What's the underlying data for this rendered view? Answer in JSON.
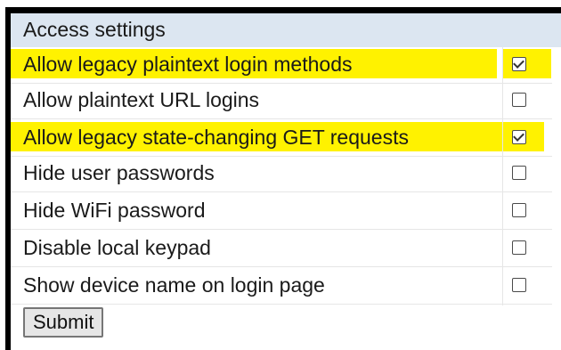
{
  "panel": {
    "title": "Access settings"
  },
  "settings": [
    {
      "label": "Allow legacy plaintext login methods",
      "checked": true,
      "highlighted": true
    },
    {
      "label": "Allow plaintext URL logins",
      "checked": false,
      "highlighted": false
    },
    {
      "label": "Allow legacy state-changing GET requests",
      "checked": true,
      "highlighted": true
    },
    {
      "label": "Hide user passwords",
      "checked": false,
      "highlighted": false
    },
    {
      "label": "Hide WiFi password",
      "checked": false,
      "highlighted": false
    },
    {
      "label": "Disable local keypad",
      "checked": false,
      "highlighted": false
    },
    {
      "label": "Show device name on login page",
      "checked": false,
      "highlighted": false
    }
  ],
  "form": {
    "submit_label": "Submit"
  },
  "colors": {
    "header_bg": "#dce6f1",
    "highlight": "#fff200",
    "border": "#000000"
  }
}
